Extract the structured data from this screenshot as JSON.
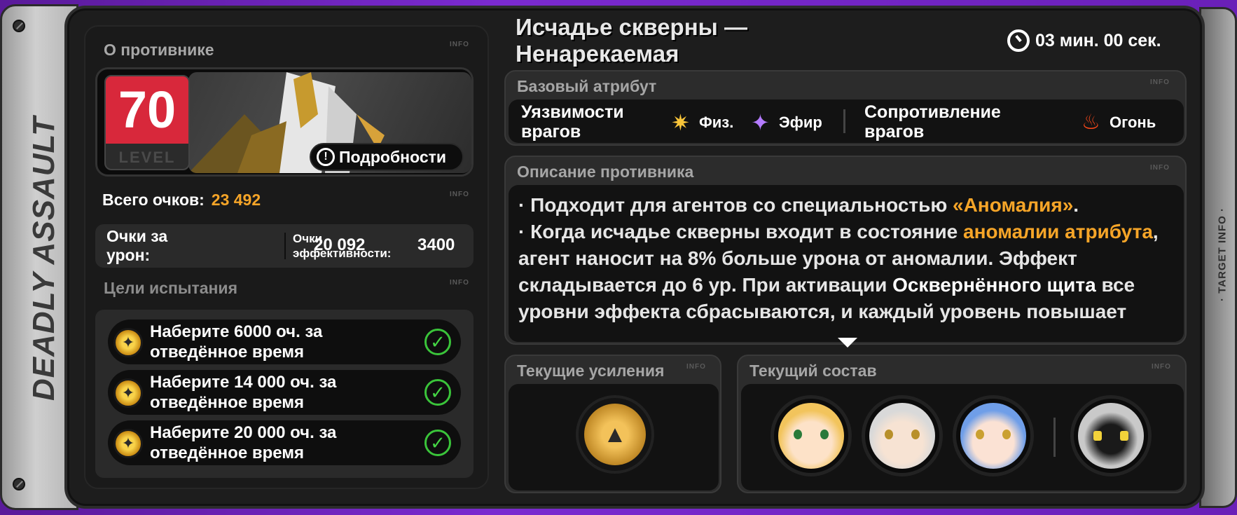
{
  "side": {
    "left_label": "DEADLY ASSAULT",
    "right_label": "· TARGET INFO ·"
  },
  "info_tag": "INFO",
  "enemy": {
    "section_title": "О противнике",
    "level": "70",
    "level_label": "LEVEL",
    "details_button": "Подробности",
    "details_icon": "!",
    "name": "Исчадье скверны —\nНенарекаемая"
  },
  "timer": {
    "value": "03 мин. 00 сек."
  },
  "scores": {
    "total_label": "Всего очков:",
    "total_value": "23 492",
    "damage_label": "Очки за\nурон:",
    "damage_value": "20 092",
    "efficiency_label": "Очки\nэффективности:",
    "efficiency_value": "3400"
  },
  "goals": {
    "section_title": "Цели испытания",
    "items": [
      {
        "text": "Наберите 6000 оч. за\nотведённое время",
        "done": "✓"
      },
      {
        "text": "Наберите 14 000 оч. за\nотведённое время",
        "done": "✓"
      },
      {
        "text": "Наберите 20 000 оч. за\nотведённое время",
        "done": "✓"
      }
    ]
  },
  "attributes": {
    "header": "Базовый атрибут",
    "weak_label": "Уязвимости\nврагов",
    "weak_items": [
      {
        "name": "Физ.",
        "icon": "physical-icon",
        "color": "#f8c43a"
      },
      {
        "name": "Эфир",
        "icon": "ether-icon",
        "color": "#b47bff"
      }
    ],
    "resist_label": "Сопротивление\nврагов",
    "resist_items": [
      {
        "name": "Огонь",
        "icon": "fire-icon",
        "color": "#ff4a1a"
      }
    ]
  },
  "description": {
    "header": "Описание противника",
    "line1_a": "· Подходит для агентов со специальностью ",
    "line1_hl": "«Аномалия»",
    "line1_b": ".",
    "line2_a": "· Когда исчадье скверны входит в состояние ",
    "line2_hl": "аномалии атрибута",
    "line2_b": ", агент наносит на 8% больше урона от аномалии. Эффект складывается до 6 ур. При активации ",
    "line2_wh": "Осквернённого щита",
    "line2_c": " все уровни эффекта сбрасываются, и каждый уровень повышает"
  },
  "buffs": {
    "header": "Текущие усиления",
    "icon": "buff-emblem-icon"
  },
  "team": {
    "header": "Текущий состав",
    "agents": [
      {
        "icon": "agent-blonde-portrait",
        "color": "#f2c45c"
      },
      {
        "icon": "agent-silver-portrait",
        "color": "#d9d9d9"
      },
      {
        "icon": "agent-blue-portrait",
        "color": "#6f9ee8"
      }
    ],
    "bangboo": {
      "icon": "bangboo-portrait",
      "color": "#c9c9c9"
    }
  },
  "colors": {
    "accent": "#f6a528",
    "level_red": "#d8283b",
    "check_green": "#3ac43a"
  }
}
